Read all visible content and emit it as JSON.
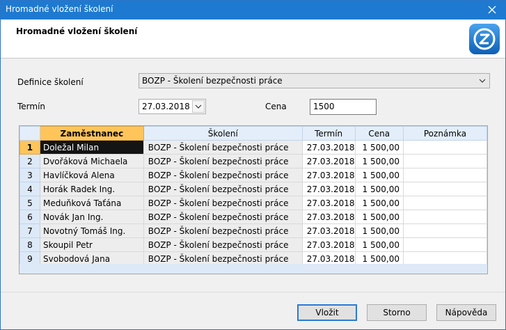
{
  "window": {
    "title": "Hromadné vložení školení",
    "close_icon": "close-icon"
  },
  "header": {
    "heading": "Hromadné vložení školení",
    "logo_icon": "app-logo-icon"
  },
  "form": {
    "definition_label": "Definice školení",
    "definition_value": "BOZP - Školení bezpečnosti práce",
    "term_label": "Termín",
    "term_value": "27.03.2018",
    "price_label": "Cena",
    "price_value": "1500"
  },
  "grid": {
    "columns": [
      "Zaměstnanec",
      "Školení",
      "Termín",
      "Cena",
      "Poznámka"
    ],
    "rows": [
      {
        "num": "1",
        "employee": "Doležal Milan",
        "course": "BOZP - Školení bezpečnosti práce",
        "term": "27.03.2018",
        "price": "1 500,00",
        "note": ""
      },
      {
        "num": "2",
        "employee": "Dvořáková Michaela",
        "course": "BOZP - Školení bezpečnosti práce",
        "term": "27.03.2018",
        "price": "1 500,00",
        "note": ""
      },
      {
        "num": "3",
        "employee": "Havlíčková Alena",
        "course": "BOZP - Školení bezpečnosti práce",
        "term": "27.03.2018",
        "price": "1 500,00",
        "note": ""
      },
      {
        "num": "4",
        "employee": "Horák Radek Ing.",
        "course": "BOZP - Školení bezpečnosti práce",
        "term": "27.03.2018",
        "price": "1 500,00",
        "note": ""
      },
      {
        "num": "5",
        "employee": "Meduňková Taťána",
        "course": "BOZP - Školení bezpečnosti práce",
        "term": "27.03.2018",
        "price": "1 500,00",
        "note": ""
      },
      {
        "num": "6",
        "employee": "Novák Jan Ing.",
        "course": "BOZP - Školení bezpečnosti práce",
        "term": "27.03.2018",
        "price": "1 500,00",
        "note": ""
      },
      {
        "num": "7",
        "employee": "Novotný Tomáš Ing.",
        "course": "BOZP - Školení bezpečnosti práce",
        "term": "27.03.2018",
        "price": "1 500,00",
        "note": ""
      },
      {
        "num": "8",
        "employee": "Skoupil Petr",
        "course": "BOZP - Školení bezpečnosti práce",
        "term": "27.03.2018",
        "price": "1 500,00",
        "note": ""
      },
      {
        "num": "9",
        "employee": "Svobodová Jana",
        "course": "BOZP - Školení bezpečnosti práce",
        "term": "27.03.2018",
        "price": "1 500,00",
        "note": ""
      }
    ],
    "selected_row": "1",
    "active_column": "Zaměstnanec"
  },
  "buttons": {
    "ok": "Vložit",
    "cancel": "Storno",
    "help": "Nápověda"
  },
  "colors": {
    "titlebar": "#1e7ad0",
    "accent": "#ffc55a",
    "header_fill": "#e3eefa"
  }
}
